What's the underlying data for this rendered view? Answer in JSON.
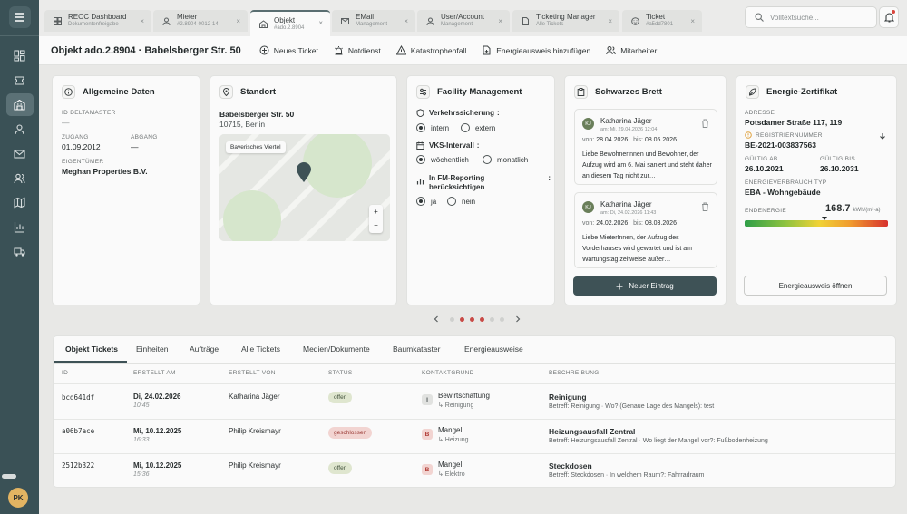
{
  "sidebar": {
    "avatar": "PK"
  },
  "tabs": [
    {
      "title": "REOC Dashboard",
      "subtitle": "Dokumentenfreigabe"
    },
    {
      "title": "Mieter",
      "subtitle": "#2.8904-0012-14"
    },
    {
      "title": "Objekt",
      "subtitle": "#ado.2.8904"
    },
    {
      "title": "EMail",
      "subtitle": "Management"
    },
    {
      "title": "User/Account",
      "subtitle": "Management"
    },
    {
      "title": "Ticketing Manager",
      "subtitle": "Alle Tickets"
    },
    {
      "title": "Ticket",
      "subtitle": "#a5dd7801"
    }
  ],
  "search": {
    "placeholder": "Volltextsuche..."
  },
  "header": {
    "title": "Objekt ado.2.8904 · Babelsberger Str. 50",
    "actions": [
      "Neues Ticket",
      "Notdienst",
      "Katastrophenfall",
      "Energieausweis hinzufügen",
      "Mitarbeiter"
    ]
  },
  "allgemein": {
    "title": "Allgemeine Daten",
    "id_label": "ID DELTAMASTER",
    "id_value": "—",
    "zugang_label": "ZUGANG",
    "zugang_value": "01.09.2012",
    "abgang_label": "ABGANG",
    "abgang_value": "—",
    "eigentuemer_label": "EIGENTÜMER",
    "eigentuemer_value": "Meghan Properties B.V."
  },
  "standort": {
    "title": "Standort",
    "street": "Babelsberger Str. 50",
    "city": "10715, Berlin",
    "map_label": "Bayerisches Viertel",
    "zoom_in": "+",
    "zoom_out": "−"
  },
  "facility": {
    "title": "Facility Management",
    "q1": "Verkehrssicherung",
    "q1_opts": [
      "intern",
      "extern"
    ],
    "q1_selected": "intern",
    "q2": "VKS-Intervall",
    "q2_opts": [
      "wöchentlich",
      "monatlich"
    ],
    "q2_selected": "wöchentlich",
    "q3": "In FM-Reporting berücksichtigen",
    "q3_opts": [
      "ja",
      "nein"
    ],
    "q3_selected": "ja"
  },
  "brett": {
    "title": "Schwarzes Brett",
    "posts": [
      {
        "initials": "KJ",
        "name": "Katharina Jäger",
        "meta": "am: Mi, 29.04.2026 12:04",
        "von_label": "von:",
        "von": "28.04.2026",
        "bis_label": "bis:",
        "bis": "08.05.2026",
        "text": "Liebe Bewohnerinnen und Bewohner, der Aufzug wird am 6. Mai saniert und steht daher an diesem Tag nicht zur…"
      },
      {
        "initials": "KJ",
        "name": "Katharina Jäger",
        "meta": "am: Di, 24.02.2026 11:43",
        "von_label": "von:",
        "von": "24.02.2026",
        "bis_label": "bis:",
        "bis": "08.03.2026",
        "text": "Liebe MieterInnen, der Aufzug des Vorderhauses wird gewartet und ist am Wartungstag zeitweise außer…"
      }
    ],
    "new_button": "Neuer Eintrag"
  },
  "energie": {
    "title": "Energie-Zertifikat",
    "adresse_label": "ADRESSE",
    "adresse": "Potsdamer Straße 117, 119",
    "reg_label": "REGISTRIERNUMMER",
    "reg": "BE-2021-003837563",
    "ab_label": "GÜLTIG AB",
    "ab": "26.10.2021",
    "bis_label": "GÜLTIG BIS",
    "bis": "26.10.2031",
    "typ_label": "ENERGIEVERBRAUCH TYP",
    "typ": "EBA - Wohngebäude",
    "end_label": "ENDENERGIE",
    "end_value": "168.7",
    "end_unit": "kWh/(m²·a)",
    "indicator_fraction": 0.56,
    "open_button": "Energieausweis öffnen"
  },
  "pager": {
    "count": 6,
    "active": [
      1,
      2,
      3
    ]
  },
  "table_tabs": [
    "Objekt Tickets",
    "Einheiten",
    "Aufträge",
    "Alle Tickets",
    "Medien/Dokumente",
    "Baumkataster",
    "Energieausweise"
  ],
  "columns": [
    "ID",
    "ERSTELLT AM",
    "ERSTELLT VON",
    "STATUS",
    "KONTAKTGRUND",
    "BESCHREIBUNG"
  ],
  "rows": [
    {
      "id": "bcd641df",
      "date": "Di, 24.02.2026",
      "time": "10:45",
      "by": "Katharina Jäger",
      "status": "offen",
      "kt_badge": "I",
      "kt": "Bewirtschaftung",
      "kt_sub": "↳ Reinigung",
      "desc_title": "Reinigung",
      "desc_sub": "Betreff: Reinigung · Wo? (Genaue Lage des Mangels): test"
    },
    {
      "id": "a06b7ace",
      "date": "Mi, 10.12.2025",
      "time": "16:33",
      "by": "Philip Kreismayr",
      "status": "geschlossen",
      "kt_badge": "B",
      "kt": "Mangel",
      "kt_sub": "↳ Heizung",
      "desc_title": "Heizungsausfall Zentral",
      "desc_sub": "Betreff: Heizungsausfall Zentral · Wo liegt der Mangel vor?: Fußbodenheizung"
    },
    {
      "id": "2512b322",
      "date": "Mi, 10.12.2025",
      "time": "15:36",
      "by": "Philip Kreismayr",
      "status": "offen",
      "kt_badge": "B",
      "kt": "Mangel",
      "kt_sub": "↳ Elektro",
      "desc_title": "Steckdosen",
      "desc_sub": "Betreff: Steckdosen · In welchem Raum?: Fahrradraum"
    }
  ]
}
